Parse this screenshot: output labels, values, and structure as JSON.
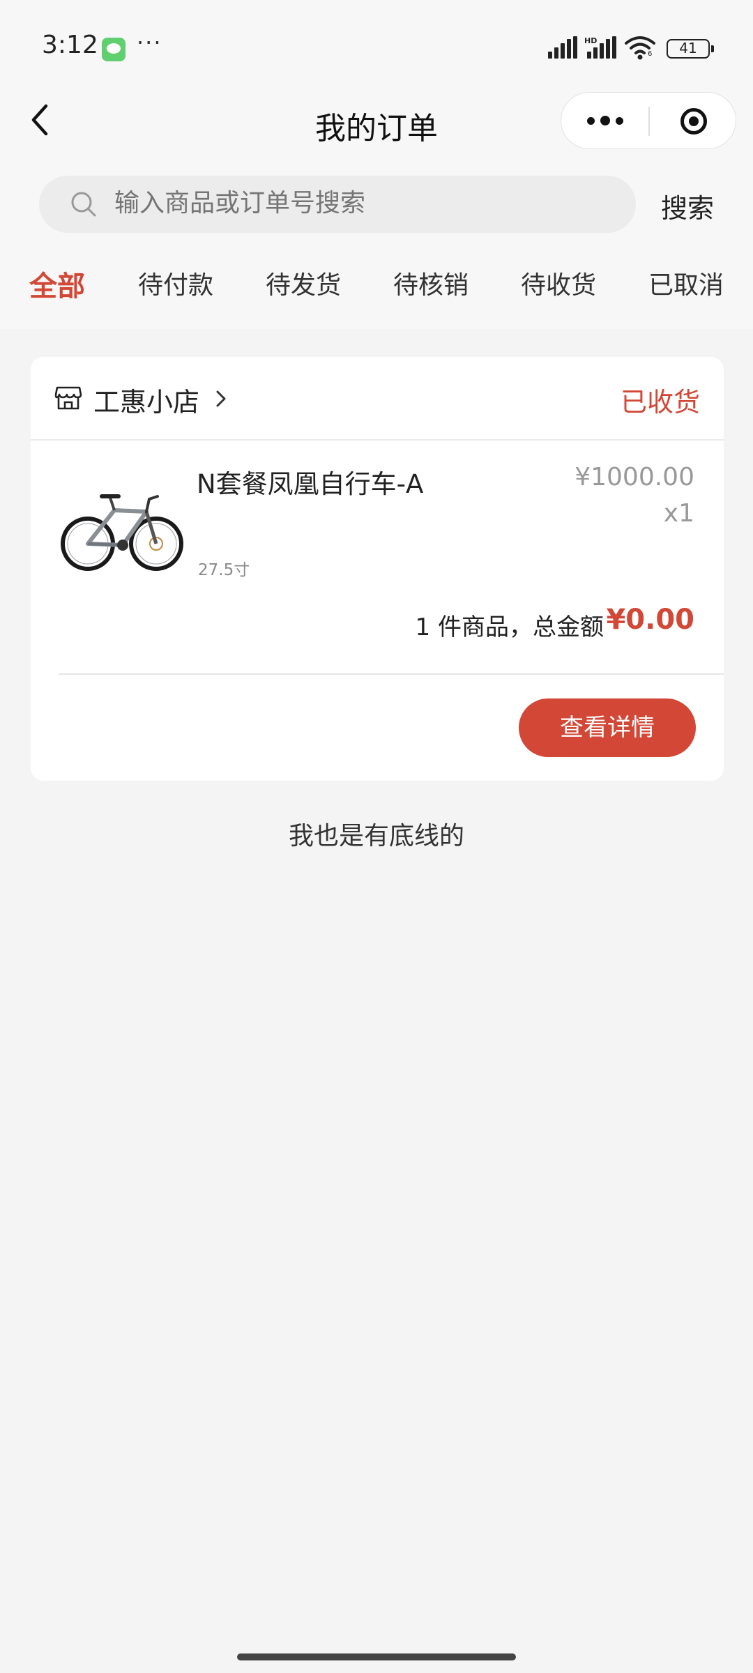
{
  "status_bar": {
    "time": "3:12",
    "more_dots": "···",
    "hd": "HD",
    "wifi_sub": "6",
    "battery": "41"
  },
  "nav": {
    "title": "我的订单"
  },
  "search": {
    "placeholder": "输入商品或订单号搜索",
    "button_label": "搜索"
  },
  "tabs": [
    {
      "label": "全部",
      "active": true
    },
    {
      "label": "待付款"
    },
    {
      "label": "待发货"
    },
    {
      "label": "待核销"
    },
    {
      "label": "待收货"
    },
    {
      "label": "已取消"
    }
  ],
  "order": {
    "shop_name": "工惠小店",
    "status": "已收货",
    "product": {
      "name": "N套餐凤凰自行车-A",
      "spec": "27.5寸",
      "price": "¥1000.00",
      "quantity": "x1"
    },
    "summary_text": "1 件商品，总金额",
    "total": "¥0.00",
    "details_label": "查看详情"
  },
  "list_end_text": "我也是有底线的",
  "colors": {
    "accent": "#d24735",
    "page_bg": "#f4f4f4",
    "card_bg": "#ffffff"
  }
}
